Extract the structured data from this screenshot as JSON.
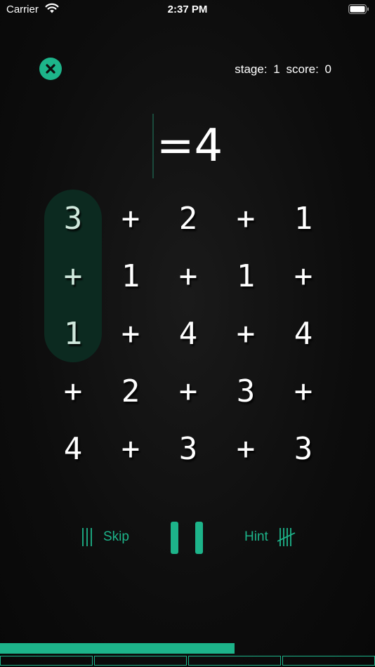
{
  "status_bar": {
    "carrier": "Carrier",
    "time": "2:37 PM"
  },
  "stats": {
    "stage_label": "stage:",
    "stage_value": "1",
    "score_label": "score:",
    "score_value": "0"
  },
  "equation": {
    "text": "=4"
  },
  "grid": [
    [
      "3",
      "+",
      "2",
      "+",
      "1"
    ],
    [
      "+",
      "1",
      "+",
      "1",
      "+"
    ],
    [
      "1",
      "+",
      "4",
      "+",
      "4"
    ],
    [
      "+",
      "2",
      "+",
      "3",
      "+"
    ],
    [
      "4",
      "+",
      "3",
      "+",
      "3"
    ]
  ],
  "selection": {
    "column": 0,
    "rows": [
      0,
      1,
      2
    ]
  },
  "controls": {
    "skip_label": "Skip",
    "hint_label": "Hint"
  },
  "progress": {
    "fraction": 0.625,
    "segments": 4
  },
  "colors": {
    "accent": "#1db48a",
    "selection": "#0c2a20",
    "background": "#0d0d0d"
  }
}
